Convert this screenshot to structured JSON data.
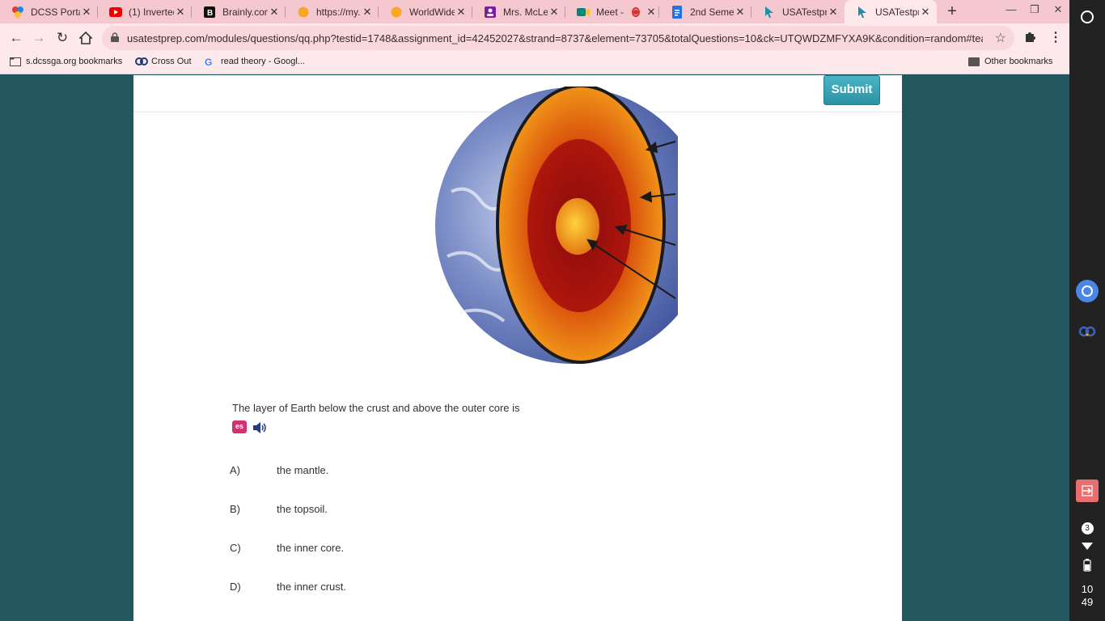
{
  "tabs": [
    {
      "title": "DCSS Portal",
      "icon": "portal-icon",
      "active": false
    },
    {
      "title": "(1) Inverted",
      "icon": "youtube-icon",
      "active": false
    },
    {
      "title": "Brainly.com",
      "icon": "brainly-icon",
      "active": false
    },
    {
      "title": "https://my.l",
      "icon": "circle-icon",
      "active": false
    },
    {
      "title": "WorldWideT",
      "icon": "circle-icon",
      "active": false
    },
    {
      "title": "Mrs. McLest",
      "icon": "classroom-icon",
      "active": false
    },
    {
      "title": "Meet - u",
      "icon": "meet-icon",
      "active": false
    },
    {
      "title": "2nd Semest",
      "icon": "docs-icon",
      "active": false
    },
    {
      "title": "USATestpre",
      "icon": "cursor-icon",
      "active": false
    },
    {
      "title": "USATestpre",
      "icon": "cursor-icon",
      "active": true
    }
  ],
  "address_bar": {
    "url": "usatestprep.com/modules/questions/qq.php?testid=1748&assignment_id=42452027&strand=8737&element=73705&totalQuestions=10&ck=UTQWDZMFYXA9K&condition=random#teac..."
  },
  "bookmarks": {
    "items": [
      "s.dcssga.org bookmarks",
      "Cross Out",
      "read theory - Googl..."
    ],
    "other": "Other bookmarks"
  },
  "page": {
    "submit_label": "Submit",
    "question": "The layer of Earth below the crust and above the outer core is",
    "answers": [
      {
        "letter": "A)",
        "text": "the mantle."
      },
      {
        "letter": "B)",
        "text": "the topsoil."
      },
      {
        "letter": "C)",
        "text": "the inner core."
      },
      {
        "letter": "D)",
        "text": "the inner crust."
      }
    ]
  },
  "shelf": {
    "notification_count": "3",
    "time_hour": "10",
    "time_minute": "49"
  },
  "colors": {
    "page_background": "#22575f",
    "tab_strip": "#f5c8cf",
    "toolbar": "#fde9ec",
    "submit_button": "#3aa3b5"
  }
}
